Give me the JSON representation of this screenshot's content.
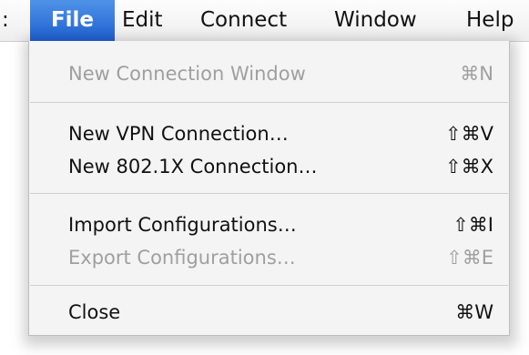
{
  "menubar": {
    "leading_fragment": ":",
    "items": [
      {
        "label": "File",
        "active": true
      },
      {
        "label": "Edit",
        "active": false
      },
      {
        "label": "Connect",
        "active": false
      },
      {
        "label": "Window",
        "active": false
      },
      {
        "label": "Help",
        "active": false
      }
    ]
  },
  "file_menu": {
    "items": [
      {
        "label": "New Connection Window",
        "shortcut": "⌘N",
        "enabled": false
      },
      {
        "label": "New VPN Connection…",
        "shortcut": "⇧⌘V",
        "enabled": true
      },
      {
        "label": "New 802.1X Connection…",
        "shortcut": "⇧⌘X",
        "enabled": true
      },
      {
        "label": "Import Configurations…",
        "shortcut": "⇧⌘I",
        "enabled": true
      },
      {
        "label": "Export Configurations…",
        "shortcut": "⇧⌘E",
        "enabled": false
      },
      {
        "label": "Close",
        "shortcut": "⌘W",
        "enabled": true
      }
    ]
  },
  "colors": {
    "menubar_highlight": "#2a6fdb",
    "disabled_text": "#9f9f9f",
    "menu_background": "#f4f4f4"
  }
}
